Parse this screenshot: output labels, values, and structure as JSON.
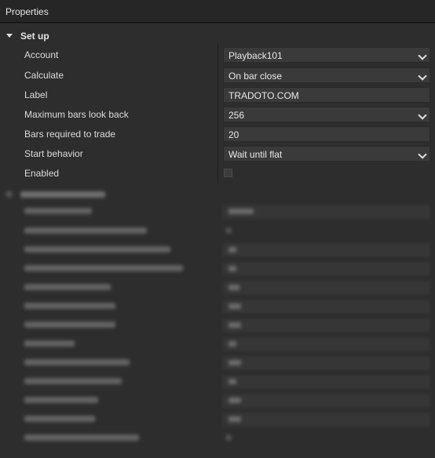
{
  "window": {
    "title": "Properties"
  },
  "category": {
    "label": "Set up"
  },
  "rows": [
    {
      "name": "Account",
      "value": "Playback101",
      "type": "dropdown"
    },
    {
      "name": "Calculate",
      "value": "On bar close",
      "type": "dropdown"
    },
    {
      "name": "Label",
      "value": "TRADOTO.COM",
      "type": "text"
    },
    {
      "name": "Maximum bars look back",
      "value": "256",
      "type": "dropdown"
    },
    {
      "name": "Bars required to trade",
      "value": "20",
      "type": "text"
    },
    {
      "name": "Start behavior",
      "value": "Wait until flat",
      "type": "dropdown"
    },
    {
      "name": "Enabled",
      "value": "",
      "type": "checkbox",
      "checked": false
    }
  ]
}
